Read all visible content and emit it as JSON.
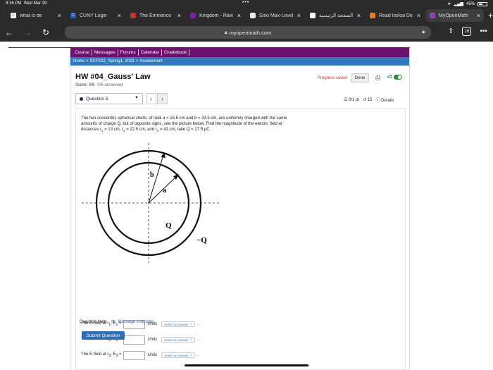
{
  "status_bar": {
    "time": "9:16 PM",
    "date": "Wed Mar 29",
    "battery": "45%"
  },
  "tabs": [
    {
      "label": "what is de",
      "icon": "google-icon",
      "color": "#ffffff"
    },
    {
      "label": "CUNY Login",
      "icon": "cuny-icon",
      "color": "#2d5aa8"
    },
    {
      "label": "The Eminence",
      "icon": "page-icon",
      "color": "#c0392b"
    },
    {
      "label": "Kingdom - Raw",
      "icon": "page-icon",
      "color": "#7a1fa0"
    },
    {
      "label": "Solo Max-Level",
      "icon": "page-icon",
      "color": "#e8e8e8"
    },
    {
      "label": "الصفحة الرئيسية",
      "icon": "page-icon",
      "color": "#ffffff"
    },
    {
      "label": "Read Isekai De",
      "icon": "page-icon",
      "color": "#e67e22"
    },
    {
      "label": "MyOpenMath",
      "icon": "myopenmath-icon",
      "color": "#8e44ad"
    }
  ],
  "address_bar": {
    "url": "myopenmath.com",
    "tab_count": "16"
  },
  "course_nav": [
    "Course",
    "Messages",
    "Forums",
    "Calendar",
    "Gradebook"
  ],
  "breadcrumb": {
    "home": "Home",
    "course": "SCP232_Spring1, 2023",
    "page": "Assessment"
  },
  "assessment": {
    "title": "HW #04_Gauss' Law",
    "score": "Score: 0/6",
    "answered": "0/6 answered",
    "progress_saved": "Progress saved",
    "done_label": "Done",
    "sqrt_label": "√0"
  },
  "question_nav": {
    "current": "Question 5",
    "points": "0/1 pt",
    "retries": "15",
    "details": "Details"
  },
  "question": {
    "line1": "The two concentric spherical shells, of radii a = 15.5 cm and b = 33.5 cm, are uniformly charged with the same",
    "line2": "amounts of charge Q, but of opposite signs, see the picture below. Find the magnitude of the electric field at",
    "line3_prefix": "distances r",
    "r1": " = 13 cm, r",
    "r2": " = 22.5 cm, and r",
    "r3": " = 43 cm, take Q = 17.5 μC."
  },
  "figure": {
    "label_b": "b",
    "label_a": "a",
    "label_q": "Q",
    "label_negq": "−Q"
  },
  "fields": [
    {
      "label": "The E-field at r",
      "sub": "1",
      "mid": ", E",
      "eq": " =",
      "units": "Units",
      "select": "Select an answer"
    },
    {
      "label": "The E-field at r",
      "sub": "2",
      "mid": ", E",
      "eq": " =",
      "units": "Units",
      "select": "Select an answer"
    },
    {
      "label": "The E-field at r",
      "sub": "3",
      "mid": ", E",
      "eq": " =",
      "units": "Units",
      "select": "Select an answer"
    }
  ],
  "help": {
    "label": "Question Help:",
    "link": "Message instructor"
  },
  "submit_label": "Submit Question"
}
